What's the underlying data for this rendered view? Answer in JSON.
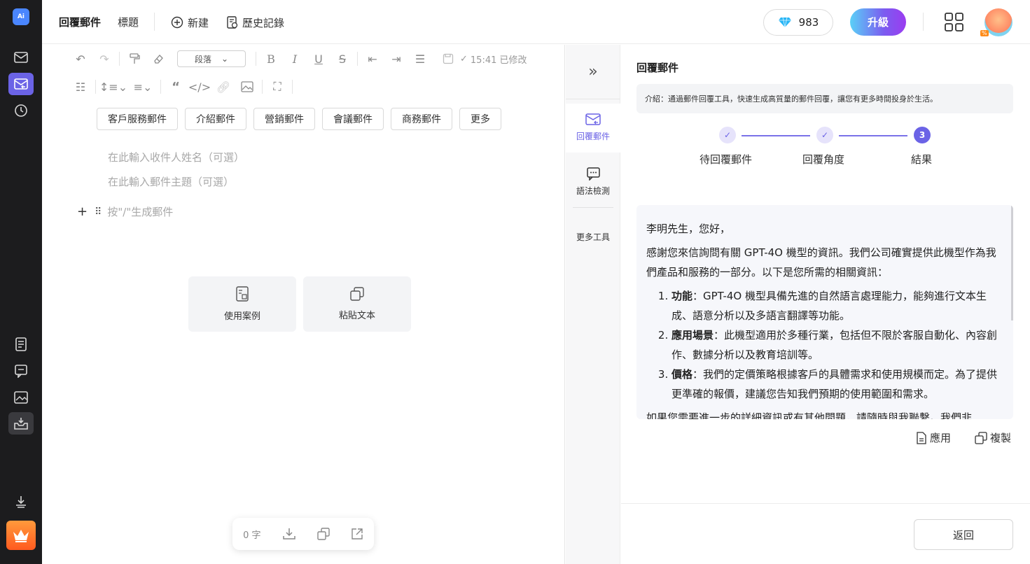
{
  "rail": {
    "logo": "Ai",
    "icons": [
      "mail-icon",
      "reply-mail-icon",
      "history-icon",
      "document-icon",
      "chat-icon",
      "image-icon",
      "inbox-icon",
      "download-icon",
      "crown-icon"
    ]
  },
  "header": {
    "title": "回覆郵件",
    "tab": "標題",
    "new_label": "新建",
    "history_label": "歷史記錄",
    "gems": "983",
    "upgrade_label": "升級",
    "avatar_badge": "%"
  },
  "editor": {
    "paragraph_select": "段落",
    "saved_status": "15:41 已修改",
    "chips": [
      "客戶服務郵件",
      "介紹郵件",
      "營銷郵件",
      "會議郵件",
      "商務郵件",
      "更多"
    ],
    "recipient_placeholder": "在此輸入收件人姓名（可選）",
    "subject_placeholder": "在此輸入郵件主題（可選）",
    "generate_hint": "按\"/\"生成郵件",
    "cards": [
      {
        "label": "使用案例",
        "icon": "document-icon"
      },
      {
        "label": "粘貼文本",
        "icon": "paste-icon"
      }
    ],
    "word_count": "0 字"
  },
  "tools": {
    "items": [
      {
        "label": "回覆郵件",
        "icon": "reply-mail-icon"
      },
      {
        "label": "語法檢測",
        "icon": "grammar-icon"
      },
      {
        "label": "更多工具",
        "icon": ""
      }
    ]
  },
  "panel": {
    "title": "回覆郵件",
    "intro": "介紹：通過郵件回覆工具，快速生成高質量的郵件回覆，讓您有更多時間投身於生活。",
    "steps": [
      {
        "label": "待回覆郵件",
        "state": "done"
      },
      {
        "label": "回覆角度",
        "state": "done"
      },
      {
        "label": "結果",
        "state": "current",
        "num": "3"
      }
    ],
    "result": {
      "greeting": "李明先生，您好，",
      "intro": "感謝您來信詢問有關 GPT-4O 機型的資訊。我們公司確實提供此機型作為我們產品和服務的一部分。以下是您所需的相關資訊：",
      "points": [
        {
          "title": "功能",
          "text": "：GPT-4O 機型具備先進的自然語言處理能力，能夠進行文本生成、語意分析以及多語言翻譯等功能。"
        },
        {
          "title": "應用場景",
          "text": "：此機型適用於多種行業，包括但不限於客服自動化、內容創作、數據分析以及教育培訓等。"
        },
        {
          "title": "價格",
          "text": "：我們的定價策略根據客戶的具體需求和使用規模而定。為了提供更準確的報價，建議您告知我們預期的使用範圍和需求。"
        }
      ],
      "closing": "如果您需要進一步的詳細資訊或有其他問題，請隨時與我聯繫。我們非"
    },
    "apply_label": "應用",
    "copy_label": "複製",
    "back_label": "返回"
  },
  "colors": {
    "accent": "#6b63e6",
    "rail": "#1c1c1e"
  }
}
